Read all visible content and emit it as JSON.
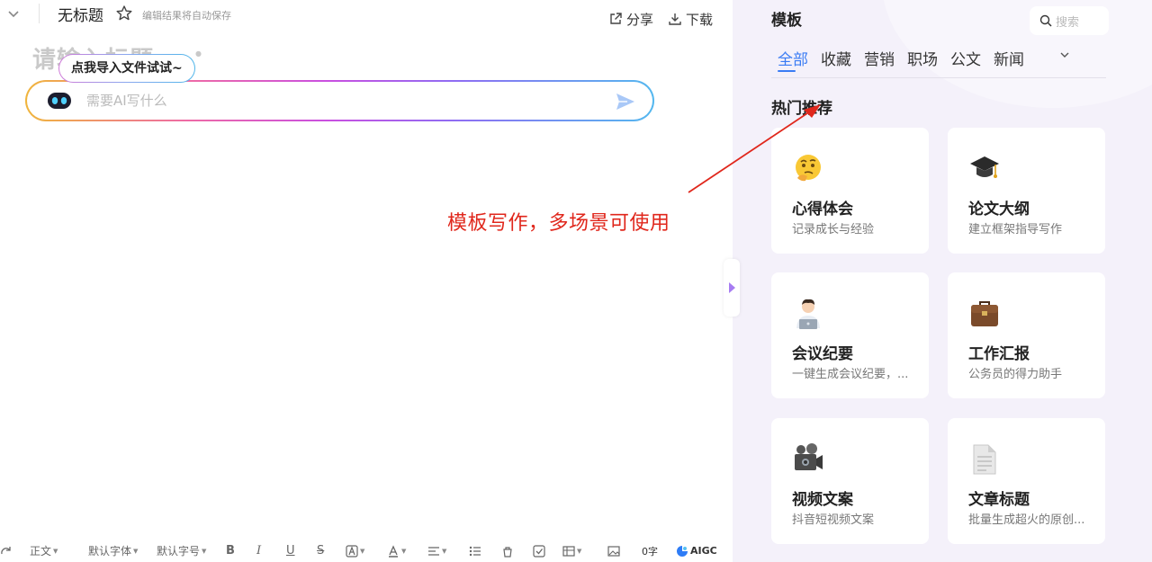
{
  "editor": {
    "doc_title": "无标题",
    "autosave_note": "编辑结果将自动保存",
    "share_label": "分享",
    "download_label": "下载",
    "title_placeholder": "请输入标题",
    "import_tip": "点我导入文件试试~",
    "ai_placeholder": "需要AI写什么"
  },
  "annotation": {
    "text": "模板写作，多场景可使用",
    "color": "#e0271c"
  },
  "toolbar": {
    "paragraph_style": "正文",
    "font_family": "默认字体",
    "font_size": "默认字号",
    "word_count": "0字",
    "aigc_label": "AIGC"
  },
  "templates": {
    "panel_title": "模板",
    "search_placeholder": "搜索",
    "tabs": [
      {
        "label": "全部",
        "active": true
      },
      {
        "label": "收藏",
        "active": false
      },
      {
        "label": "营销",
        "active": false
      },
      {
        "label": "职场",
        "active": false
      },
      {
        "label": "公文",
        "active": false
      },
      {
        "label": "新闻",
        "active": false
      }
    ],
    "section_heading": "热门推荐",
    "cards": [
      {
        "name": "心得体会",
        "desc": "记录成长与经验",
        "icon": "thinking-face-icon"
      },
      {
        "name": "论文大纲",
        "desc": "建立框架指导写作",
        "icon": "graduation-cap-icon"
      },
      {
        "name": "会议纪要",
        "desc": "一键生成会议纪要，...",
        "icon": "office-worker-icon"
      },
      {
        "name": "工作汇报",
        "desc": "公务员的得力助手",
        "icon": "briefcase-icon"
      },
      {
        "name": "视频文案",
        "desc": "抖音短视频文案",
        "icon": "video-camera-icon"
      },
      {
        "name": "文章标题",
        "desc": "批量生成超火的原创...",
        "icon": "document-icon"
      }
    ]
  },
  "colors": {
    "accent_blue": "#3a7cf4",
    "panel_bg": "#f4f1fa",
    "toggle_purple": "#a77cf2"
  }
}
